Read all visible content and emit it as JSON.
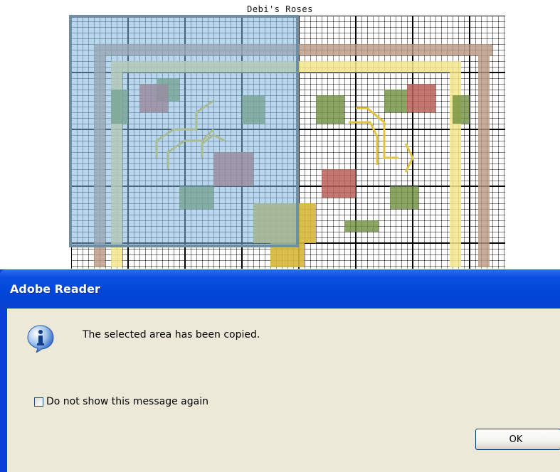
{
  "document": {
    "title": "Debi's Roses"
  },
  "dialog": {
    "title": "Adobe Reader",
    "message": "The selected area has been copied.",
    "checkbox_label": "Do not show this message again",
    "checkbox_checked": false,
    "ok_label": "OK"
  },
  "colors": {
    "titlebar": "#0047d9",
    "client_bg": "#ece9d8",
    "selection": "#7db4dc",
    "border_yellow": "#f0d84a",
    "rose": "#b85f57",
    "leaf": "#6f8f3d"
  },
  "icons": {
    "info": "info-balloon-icon"
  }
}
